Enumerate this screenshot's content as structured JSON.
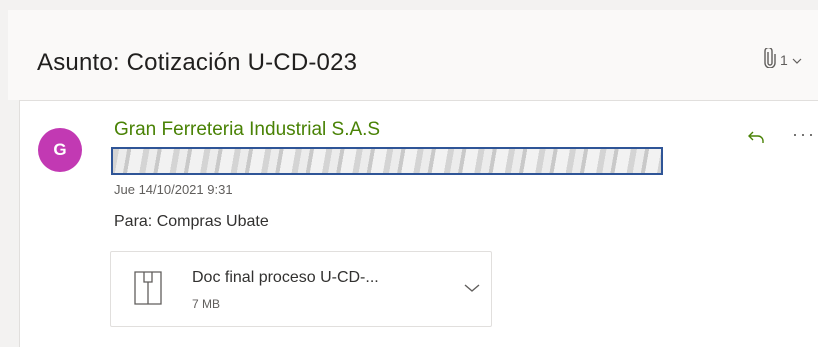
{
  "subject": "Asunto: Cotización U-CD-023",
  "attachment_count": "1",
  "sender": {
    "initial": "G",
    "name": "Gran Ferreteria Industrial S.A.S",
    "date": "Jue 14/10/2021 9:31"
  },
  "recipients": "Para:  Compras Ubate",
  "attachment": {
    "name": "Doc final proceso U-CD-...",
    "size": "7 MB"
  },
  "colors": {
    "avatar": "#c239b3",
    "sender_name": "#498205",
    "redaction_border": "#2f5597"
  }
}
